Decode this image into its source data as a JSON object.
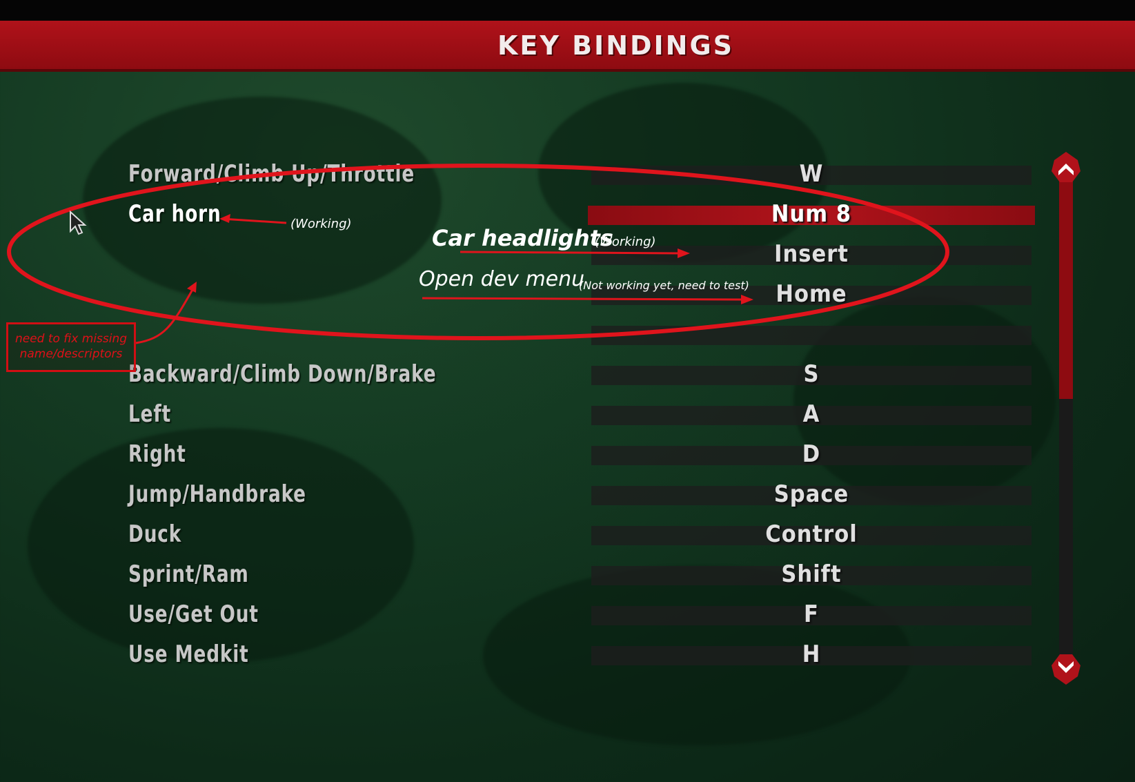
{
  "header": {
    "title": "KEY BINDINGS"
  },
  "bindings": [
    {
      "action": "Forward/Climb Up/Throttle",
      "key": "W"
    },
    {
      "action": "Car horn",
      "key": "Num 8"
    },
    {
      "action": "",
      "key": "Insert"
    },
    {
      "action": "",
      "key": "Home"
    },
    {
      "action": "",
      "key": ""
    },
    {
      "action": "Backward/Climb Down/Brake",
      "key": "S"
    },
    {
      "action": "Left",
      "key": "A"
    },
    {
      "action": "Right",
      "key": "D"
    },
    {
      "action": "Jump/Handbrake",
      "key": "Space"
    },
    {
      "action": "Duck",
      "key": "Control"
    },
    {
      "action": "Sprint/Ram",
      "key": "Shift"
    },
    {
      "action": "Use/Get Out",
      "key": "F"
    },
    {
      "action": "Use Medkit",
      "key": "H"
    }
  ],
  "selected_index": 1,
  "scrollbar": {
    "up_icon": "chevron-up-icon",
    "down_icon": "chevron-down-icon",
    "accent": "#8e0b11"
  },
  "annotations": {
    "car_horn_note": "(Working)",
    "headlights_title": "Car headlights",
    "headlights_note": "(Working)",
    "dev_menu_title": "Open dev menu",
    "dev_menu_note": "(Not working yet, need to test)",
    "missing_names_line1": "need to fix missing",
    "missing_names_line2": "name/descriptors"
  },
  "colors": {
    "header_red": "#b0121a",
    "annotation_red": "#e0141c",
    "background_green": "#143a22"
  }
}
